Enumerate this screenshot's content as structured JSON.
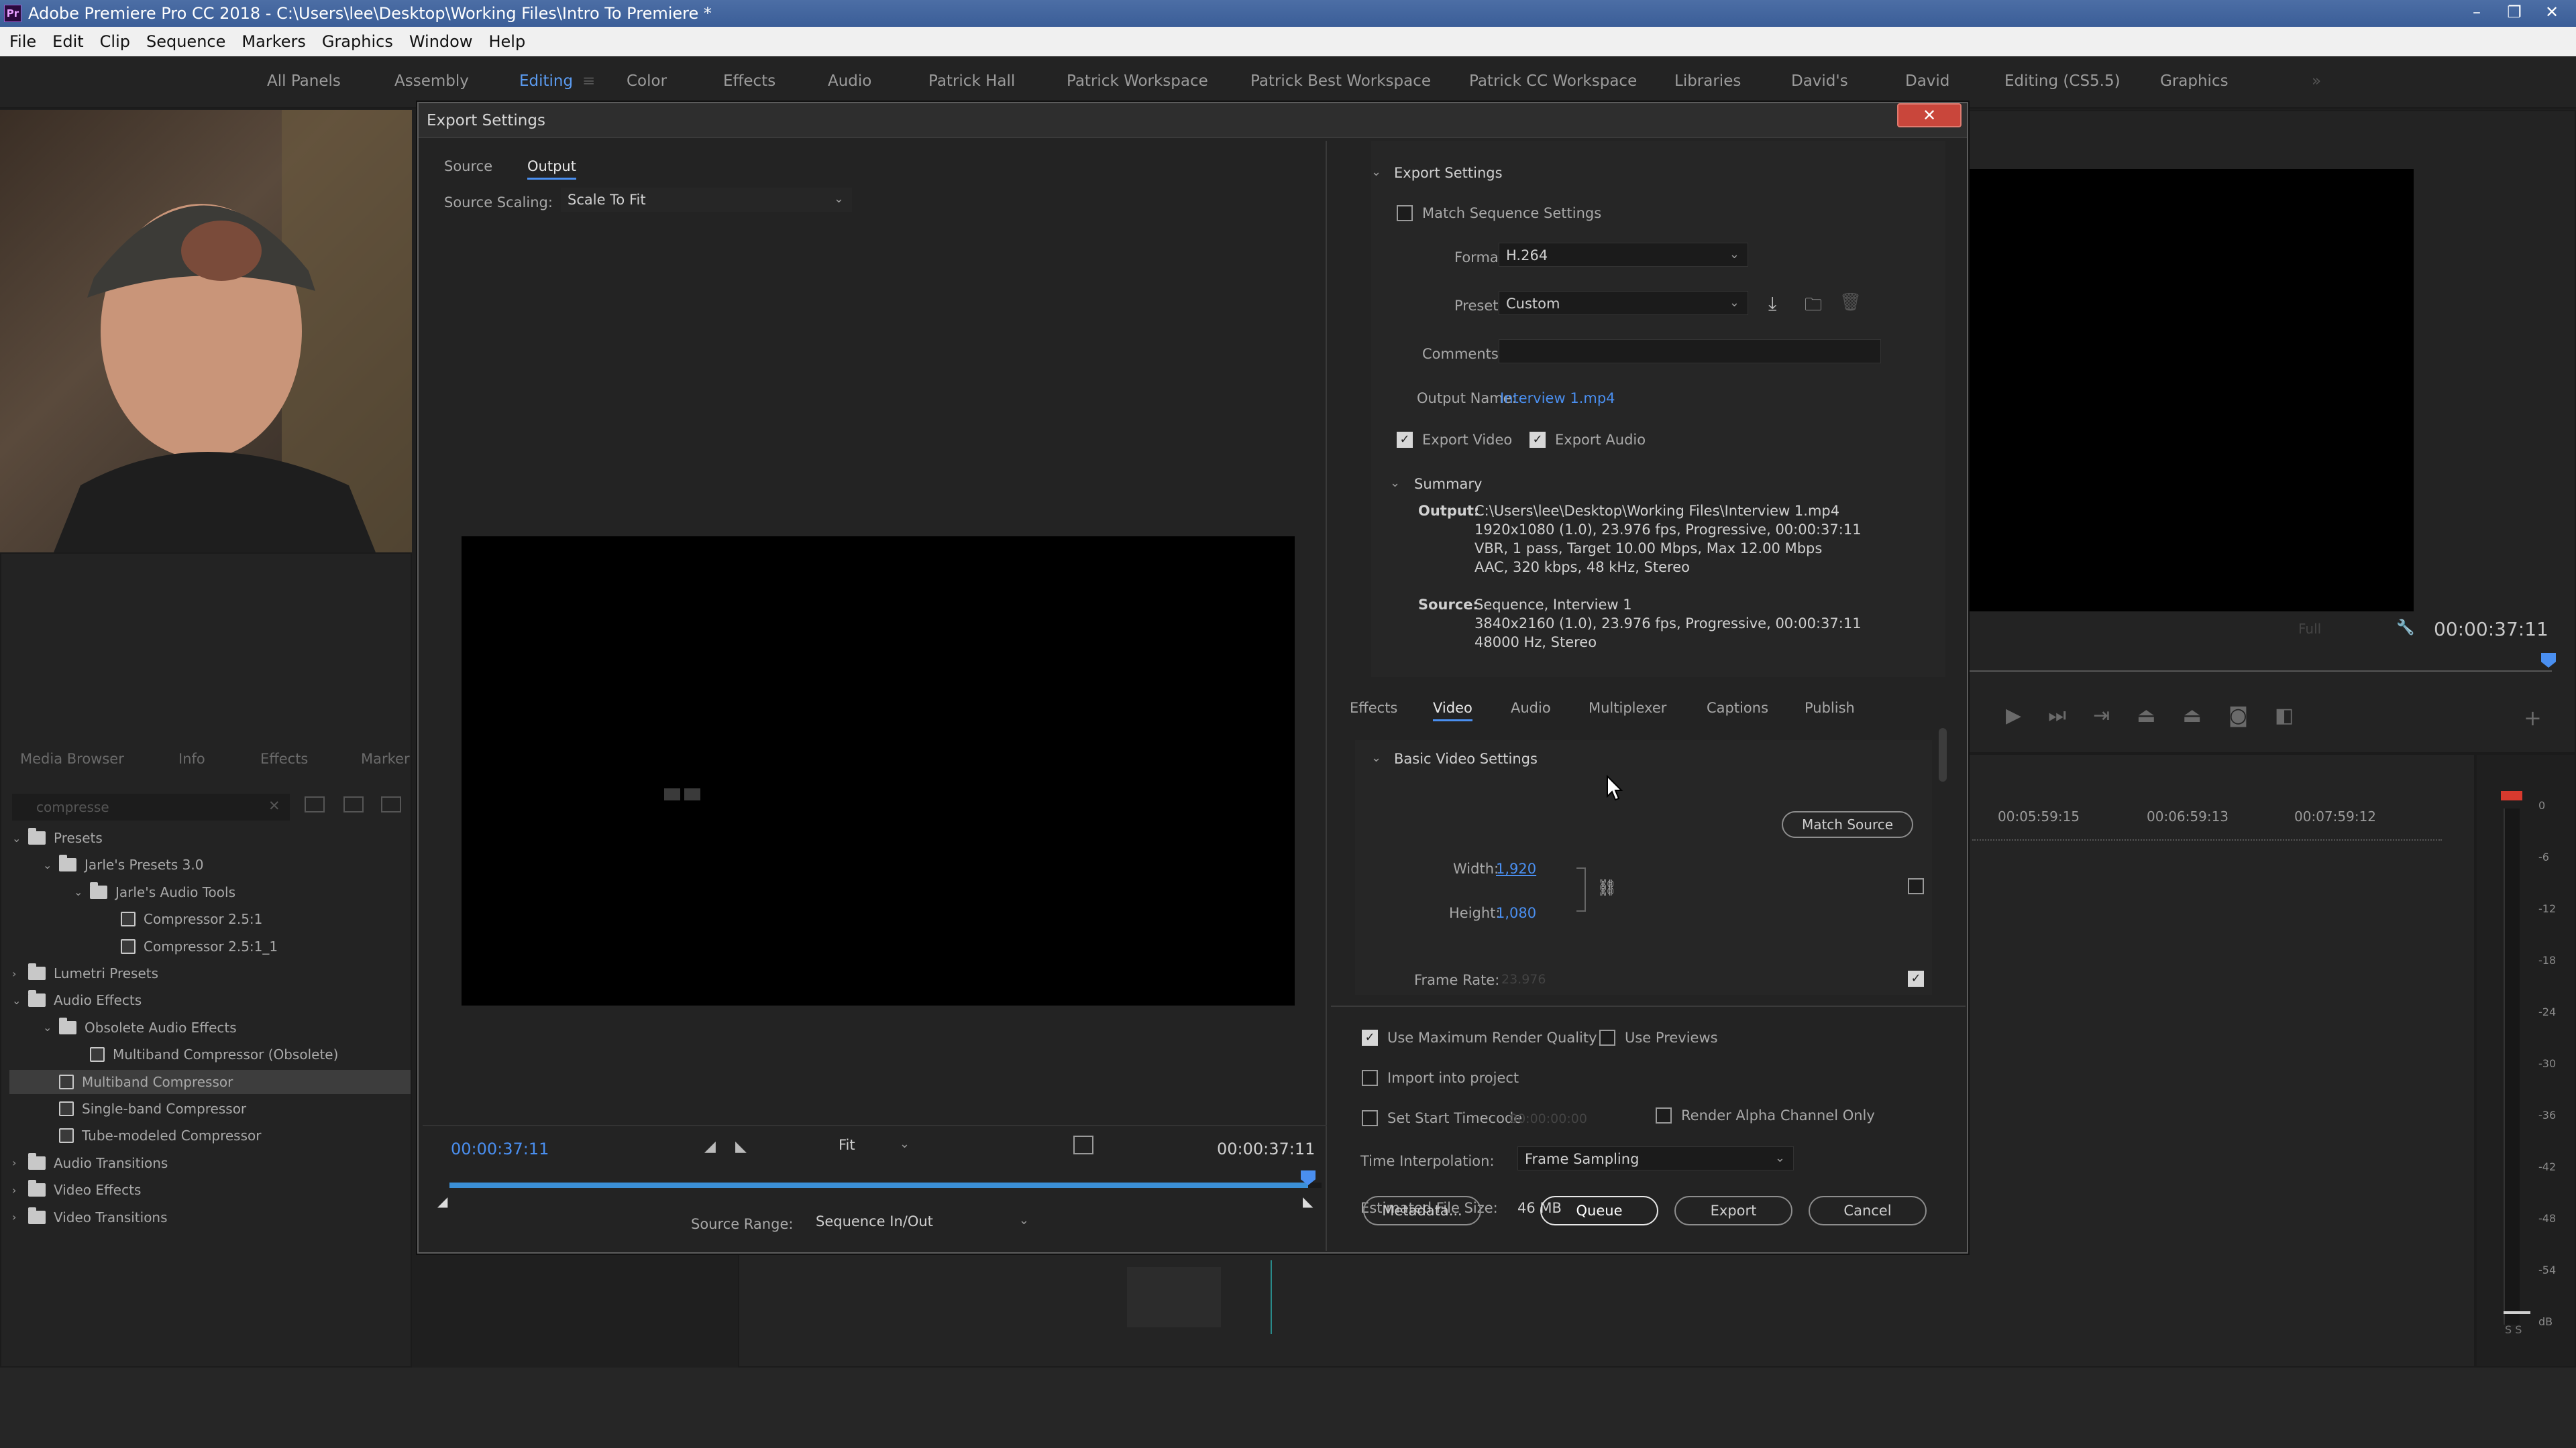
{
  "window": {
    "app_badge": "Pr",
    "title": "Adobe Premiere Pro CC 2018 - C:\\Users\\lee\\Desktop\\Working Files\\Intro To Premiere *"
  },
  "menu": [
    "File",
    "Edit",
    "Clip",
    "Sequence",
    "Markers",
    "Graphics",
    "Window",
    "Help"
  ],
  "workspaces": [
    {
      "label": "All Panels"
    },
    {
      "label": "Assembly"
    },
    {
      "label": "Editing",
      "active": true
    },
    {
      "label": "Color"
    },
    {
      "label": "Effects"
    },
    {
      "label": "Audio"
    },
    {
      "label": "Patrick Hall"
    },
    {
      "label": "Patrick Workspace"
    },
    {
      "label": "Patrick Best Workspace"
    },
    {
      "label": "Patrick CC Workspace"
    },
    {
      "label": "Libraries"
    },
    {
      "label": "David's"
    },
    {
      "label": "David"
    },
    {
      "label": "Editing (CS5.5)"
    },
    {
      "label": "Graphics"
    }
  ],
  "workspace_overflow": "»",
  "project_panel": {
    "tabs": [
      "Media Browser",
      "Info",
      "Effects",
      "Marker"
    ],
    "search_value": "compresse",
    "tree": [
      {
        "label": "Presets",
        "kind": "folder",
        "level": 0,
        "open": true
      },
      {
        "label": "Jarle's Presets 3.0",
        "kind": "folder",
        "level": 1,
        "open": true
      },
      {
        "label": "Jarle's Audio Tools",
        "kind": "folder",
        "level": 2,
        "open": true
      },
      {
        "label": "Compressor 2.5:1",
        "kind": "fx",
        "level": 3
      },
      {
        "label": "Compressor 2.5:1_1",
        "kind": "fx",
        "level": 3
      },
      {
        "label": "Lumetri Presets",
        "kind": "folder",
        "level": 0,
        "open": false
      },
      {
        "label": "Audio Effects",
        "kind": "folder",
        "level": 0,
        "open": true
      },
      {
        "label": "Obsolete Audio Effects",
        "kind": "folder",
        "level": 1,
        "open": true
      },
      {
        "label": "Multiband Compressor (Obsolete)",
        "kind": "fx",
        "level": 2
      },
      {
        "label": "Multiband Compressor",
        "kind": "fx",
        "level": 1,
        "selected": true
      },
      {
        "label": "Single-band Compressor",
        "kind": "fx",
        "level": 1
      },
      {
        "label": "Tube-modeled Compressor",
        "kind": "fx",
        "level": 1
      },
      {
        "label": "Audio Transitions",
        "kind": "folder",
        "level": 0,
        "open": false
      },
      {
        "label": "Video Effects",
        "kind": "folder",
        "level": 0,
        "open": false
      },
      {
        "label": "Video Transitions",
        "kind": "folder",
        "level": 0,
        "open": false
      }
    ]
  },
  "program_monitor": {
    "fit_label": "Full",
    "timecode": "00:00:37:11"
  },
  "timeline": {
    "timecodes": [
      "00:05:59:15",
      "00:06:59:13",
      "00:07:59:12"
    ]
  },
  "audio_meter": {
    "labels": [
      "0",
      "-6",
      "-12",
      "-18",
      "-24",
      "-30",
      "-36",
      "-42",
      "-48",
      "-54",
      "dB"
    ],
    "solo": "S S"
  },
  "dialog": {
    "title": "Export Settings",
    "close_glyph": "✕",
    "left": {
      "tabs": [
        "Source",
        "Output"
      ],
      "active_tab": "Output",
      "source_scaling_label": "Source Scaling:",
      "source_scaling_value": "Scale To Fit",
      "timecode_in": "00:00:37:11",
      "timecode_out": "00:00:37:11",
      "zoom_value": "Fit",
      "source_range_label": "Source Range:",
      "source_range_value": "Sequence In/Out",
      "playhead_fraction": 1.0
    },
    "export_settings": {
      "section_title": "Export Settings",
      "match_sequence_label": "Match Sequence Settings",
      "match_sequence_checked": false,
      "format_label": "Format:",
      "format_value": "H.264",
      "preset_label": "Preset:",
      "preset_value": "Custom",
      "comments_label": "Comments:",
      "comments_value": "",
      "output_name_label": "Output Name:",
      "output_name_value": "Interview 1.mp4",
      "export_video_label": "Export Video",
      "export_video_checked": true,
      "export_audio_label": "Export Audio",
      "export_audio_checked": true,
      "summary_title": "Summary",
      "summary_output_label": "Output:",
      "summary_output_lines": [
        "C:\\Users\\lee\\Desktop\\Working Files\\Interview 1.mp4",
        "1920x1080 (1.0), 23.976 fps, Progressive, 00:00:37:11",
        "VBR, 1 pass, Target 10.00 Mbps, Max 12.00 Mbps",
        "AAC, 320 kbps, 48 kHz, Stereo"
      ],
      "summary_source_label": "Source:",
      "summary_source_lines": [
        "Sequence, Interview 1",
        "3840x2160 (1.0), 23.976 fps, Progressive, 00:00:37:11",
        "48000 Hz, Stereo"
      ]
    },
    "settings_tabs": [
      "Effects",
      "Video",
      "Audio",
      "Multiplexer",
      "Captions",
      "Publish"
    ],
    "settings_active_tab": "Video",
    "video": {
      "section_title": "Basic Video Settings",
      "match_source_label": "Match Source",
      "width_label": "Width:",
      "width_value": "1,920",
      "height_label": "Height:",
      "height_value": "1,080",
      "frame_rate_label": "Frame Rate:",
      "frame_rate_value": "23.976"
    },
    "bottom": {
      "max_render_label": "Use Maximum Render Quality",
      "max_render_checked": true,
      "use_previews_label": "Use Previews",
      "use_previews_checked": false,
      "import_label": "Import into project",
      "import_checked": false,
      "start_timecode_label": "Set Start Timecode",
      "start_timecode_checked": false,
      "start_timecode_value": "00:00:00:00",
      "alpha_label": "Render Alpha Channel Only",
      "alpha_checked": false,
      "time_interp_label": "Time Interpolation:",
      "time_interp_value": "Frame Sampling",
      "file_size_label": "Estimated File Size:",
      "file_size_value": "46 MB",
      "metadata_label": "Metadata...",
      "queue_label": "Queue",
      "export_label": "Export",
      "cancel_label": "Cancel"
    }
  },
  "colors": {
    "accent_blue": "#4a8ff0",
    "close_red": "#c9463b",
    "title_bar": "#3b5e98"
  }
}
